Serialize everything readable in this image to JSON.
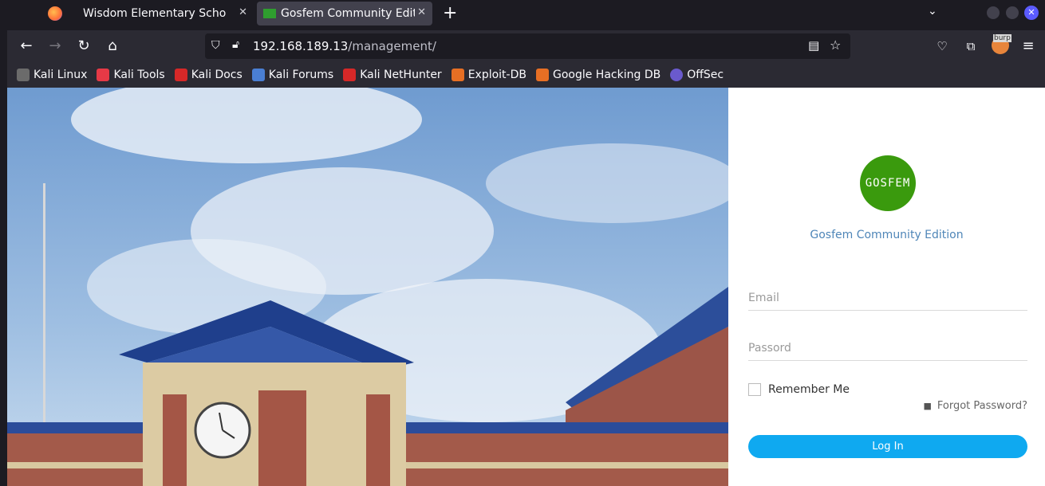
{
  "browser": {
    "tabs": [
      {
        "label": "Wisdom Elementary School",
        "active": false
      },
      {
        "label": "Gosfem Community Edition",
        "active": true
      }
    ],
    "new_tab_symbol": "+",
    "url_host": "192.168.189.13",
    "url_path": "/management/",
    "bookmarks": [
      {
        "label": "Kali Linux",
        "icon": "kali-dragon-icon",
        "color": "#6b6b6b"
      },
      {
        "label": "Kali Tools",
        "icon": "kali-tools-icon",
        "color": "#e63946"
      },
      {
        "label": "Kali Docs",
        "icon": "kali-docs-icon",
        "color": "#d62828"
      },
      {
        "label": "Kali Forums",
        "icon": "kali-forums-icon",
        "color": "#4a7fd4"
      },
      {
        "label": "Kali NetHunter",
        "icon": "nethunter-icon",
        "color": "#d62828"
      },
      {
        "label": "Exploit-DB",
        "icon": "exploit-db-icon",
        "color": "#e76f24"
      },
      {
        "label": "Google Hacking DB",
        "icon": "ghdb-icon",
        "color": "#e76f24"
      },
      {
        "label": "OffSec",
        "icon": "offsec-icon",
        "color": "#6a5acd"
      }
    ],
    "burp_label": "burp"
  },
  "login": {
    "logo_text": "GOSFEM",
    "brand": "Gosfem Community Edition",
    "email_placeholder": "Email",
    "password_placeholder": "Passord",
    "remember_label": "Remember Me",
    "forgot_label": "Forgot Password?",
    "login_button": "Log In"
  },
  "colors": {
    "logo_bg": "#3a9a0d",
    "login_button": "#0fa9f0",
    "brand_text": "#4f86b8"
  }
}
